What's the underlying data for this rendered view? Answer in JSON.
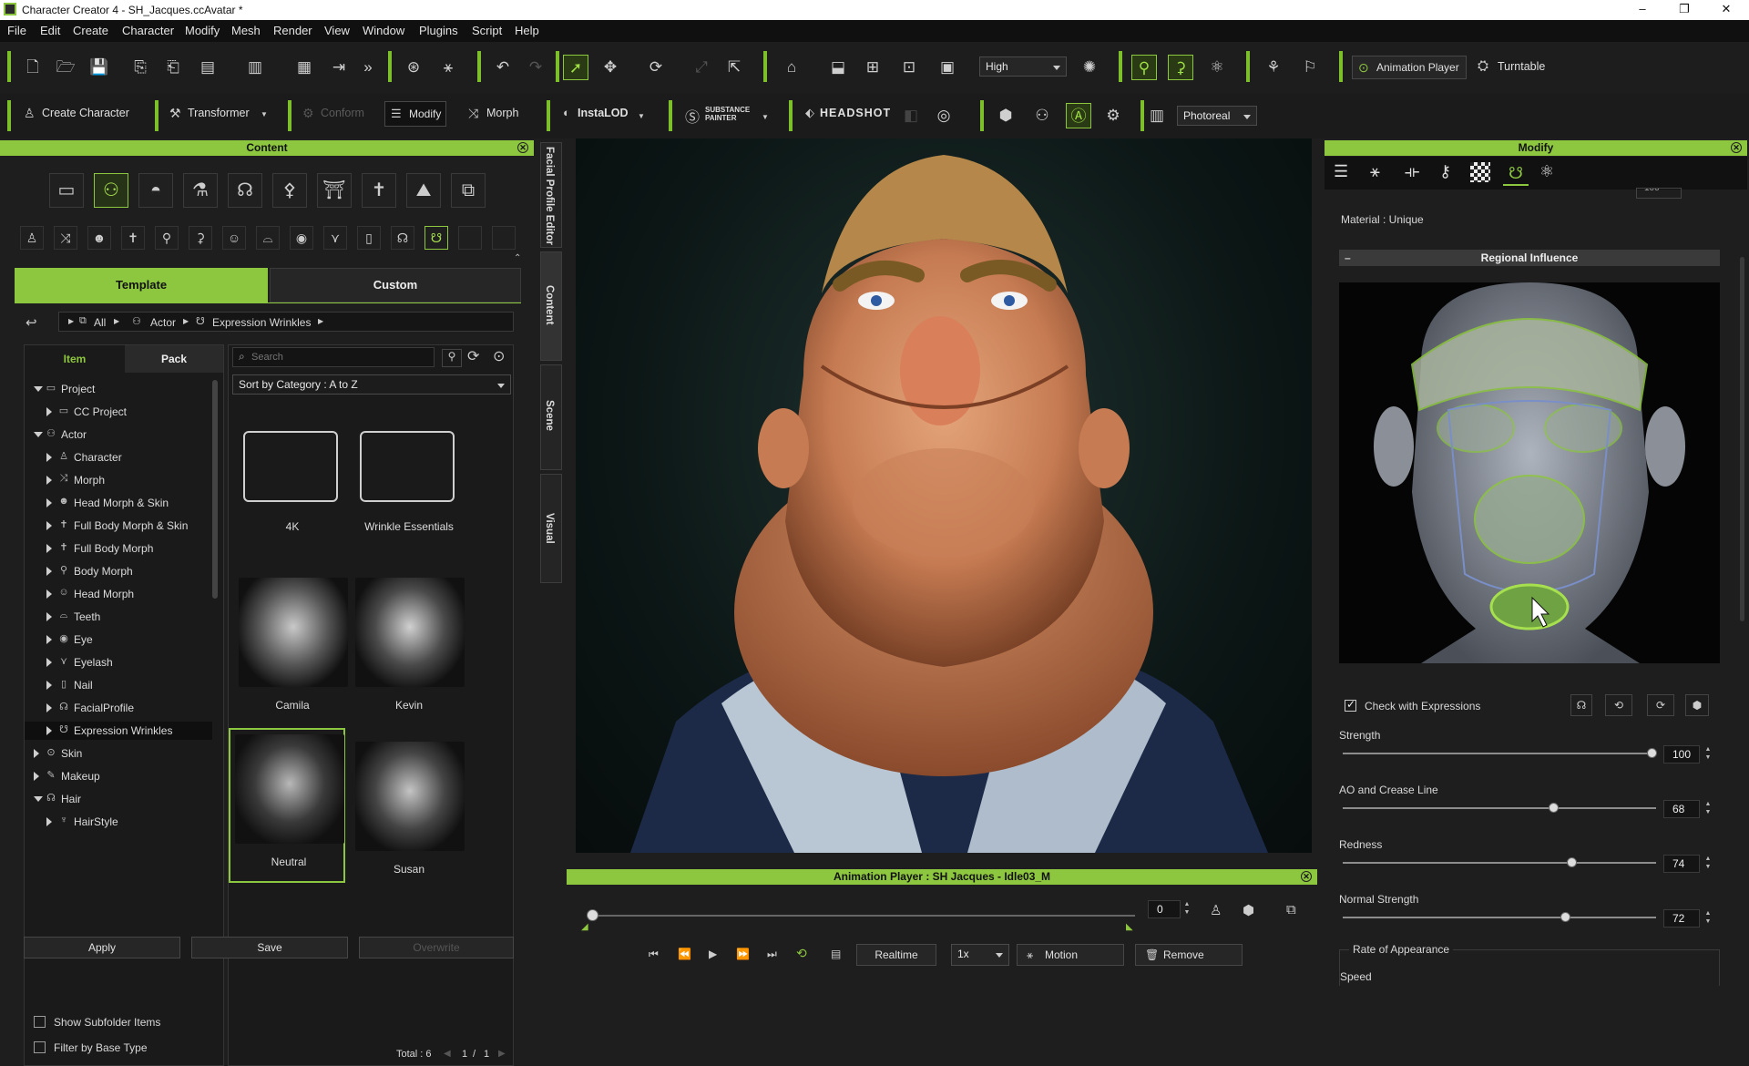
{
  "window": {
    "title": "Character Creator 4 - SH_Jacques.ccAvatar *",
    "minimize": "–",
    "maximize": "❐",
    "close": "✕"
  },
  "menu": [
    "File",
    "Edit",
    "Create",
    "Character",
    "Modify",
    "Mesh",
    "Render",
    "View",
    "Window",
    "Plugins",
    "Script",
    "Help"
  ],
  "toolbar1": {
    "quality": "High",
    "animation_player": "Animation Player",
    "turntable": "Turntable"
  },
  "toolbar2": {
    "create_character": "Create Character",
    "transformer": "Transformer",
    "conform": "Conform",
    "modify": "Modify",
    "morph": "Morph",
    "instalod": "InstaLOD",
    "substance": "SUBSTANCE PAINTER",
    "headshot": "HEADSHOT",
    "render_mode": "Photoreal"
  },
  "content": {
    "title": "Content",
    "tabs": {
      "template": "Template",
      "custom": "Custom"
    },
    "breadcrumb": [
      "All",
      "Actor",
      "Expression Wrinkles"
    ],
    "subtabs": {
      "item": "Item",
      "pack": "Pack"
    },
    "search_placeholder": "Search",
    "sort": "Sort by Category : A to Z",
    "tree": [
      {
        "label": "Project",
        "indent": 0,
        "open": true,
        "icon": "folder-icon",
        "glyph": "▭"
      },
      {
        "label": "CC Project",
        "indent": 1,
        "open": false,
        "icon": "folder-icon",
        "glyph": "▭"
      },
      {
        "label": "Actor",
        "indent": 0,
        "open": true,
        "icon": "actor-icon",
        "glyph": "⚇"
      },
      {
        "label": "Character",
        "indent": 1,
        "open": false,
        "icon": "character-icon",
        "glyph": "♙"
      },
      {
        "label": "Morph",
        "indent": 1,
        "open": false,
        "icon": "morph-icon",
        "glyph": "⤨"
      },
      {
        "label": "Head Morph & Skin",
        "indent": 1,
        "open": false,
        "icon": "head-morph-skin-icon",
        "glyph": "☻"
      },
      {
        "label": "Full Body Morph & Skin",
        "indent": 1,
        "open": false,
        "icon": "full-body-morph-skin-icon",
        "glyph": "✝"
      },
      {
        "label": "Full Body Morph",
        "indent": 1,
        "open": false,
        "icon": "full-body-morph-icon",
        "glyph": "✝"
      },
      {
        "label": "Body Morph",
        "indent": 1,
        "open": false,
        "icon": "body-morph-icon",
        "glyph": "⚲"
      },
      {
        "label": "Head Morph",
        "indent": 1,
        "open": false,
        "icon": "head-morph-icon",
        "glyph": "☺"
      },
      {
        "label": "Teeth",
        "indent": 1,
        "open": false,
        "icon": "teeth-icon",
        "glyph": "⌓"
      },
      {
        "label": "Eye",
        "indent": 1,
        "open": false,
        "icon": "eye-icon",
        "glyph": "◉"
      },
      {
        "label": "Eyelash",
        "indent": 1,
        "open": false,
        "icon": "eyelash-icon",
        "glyph": "⋎"
      },
      {
        "label": "Nail",
        "indent": 1,
        "open": false,
        "icon": "nail-icon",
        "glyph": "▯"
      },
      {
        "label": "FacialProfile",
        "indent": 1,
        "open": false,
        "icon": "facial-profile-icon",
        "glyph": "☊"
      },
      {
        "label": "Expression Wrinkles",
        "indent": 1,
        "open": false,
        "icon": "expression-wrinkles-icon",
        "glyph": "☋",
        "selected": true
      },
      {
        "label": "Skin",
        "indent": 0,
        "open": false,
        "icon": "skin-icon",
        "glyph": "⊙"
      },
      {
        "label": "Makeup",
        "indent": 0,
        "open": false,
        "icon": "makeup-icon",
        "glyph": "✎"
      },
      {
        "label": "Hair",
        "indent": 0,
        "open": true,
        "icon": "hair-icon",
        "glyph": "☊"
      },
      {
        "label": "HairStyle",
        "indent": 1,
        "open": false,
        "icon": "hairstyle-icon",
        "glyph": "♆"
      }
    ],
    "items": [
      {
        "label": "4K",
        "type": "folder"
      },
      {
        "label": "Wrinkle Essentials",
        "type": "folder"
      },
      {
        "label": "Camila",
        "type": "face"
      },
      {
        "label": "Kevin",
        "type": "face"
      },
      {
        "label": "Neutral",
        "type": "face",
        "selected": true
      },
      {
        "label": "Susan",
        "type": "face"
      }
    ],
    "show_subfolder": "Show Subfolder Items",
    "filter_base": "Filter by Base Type",
    "total": "Total : 6",
    "page": "1",
    "page_of": "/",
    "page_total": "1",
    "apply": "Apply",
    "save": "Save",
    "overwrite": "Overwrite"
  },
  "side_tabs": [
    "Facial Profile Editor",
    "Content",
    "Scene",
    "Visual"
  ],
  "animation_player": {
    "title": "Animation Player : SH Jacques - Idle03_M",
    "frame": "0",
    "realtime": "Realtime",
    "speed": "1x",
    "motion": "Motion",
    "remove": "Remove"
  },
  "modify": {
    "title": "Modify",
    "partial_value": "100",
    "material": "Material : Unique",
    "regional_influence": "Regional Influence",
    "check_expressions": "Check with Expressions",
    "sliders": [
      {
        "label": "Strength",
        "value": "100",
        "fraction": 1.0
      },
      {
        "label": "AO and Crease Line",
        "value": "68",
        "fraction": 0.68
      },
      {
        "label": "Redness",
        "value": "74",
        "fraction": 0.74
      },
      {
        "label": "Normal Strength",
        "value": "72",
        "fraction": 0.72
      }
    ],
    "rate_of_appearance": "Rate of Appearance",
    "speed": "Speed"
  },
  "colors": {
    "accent": "#8dc63f",
    "panel": "#1e1e1e",
    "viewport": "#0d1414"
  }
}
